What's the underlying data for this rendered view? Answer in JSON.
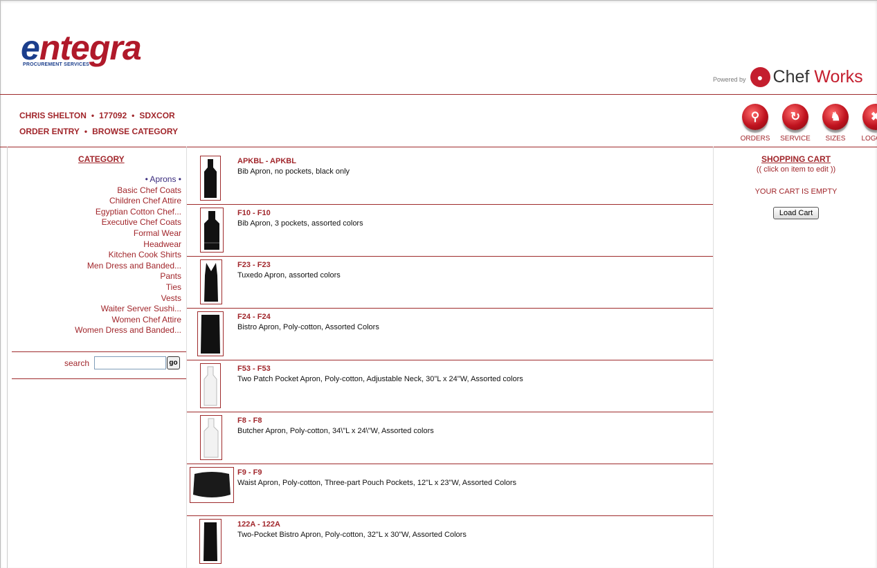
{
  "logo": {
    "word_start": "e",
    "word_rest": "ntegra",
    "subtitle": "PROCUREMENT SERVICES"
  },
  "powered": {
    "label": "Powered by",
    "brand_a": "Chef ",
    "brand_b": "Works"
  },
  "user": {
    "name": "CHRIS SHELTON",
    "id": "177092",
    "account": "SDXCOR"
  },
  "nav": {
    "order_entry": "ORDER ENTRY",
    "browse": "BROWSE CATEGORY"
  },
  "toolbar": [
    {
      "label": "ORDERS",
      "icon": "search-icon"
    },
    {
      "label": "SERVICE",
      "icon": "service-icon"
    },
    {
      "label": "SIZES",
      "icon": "pin-icon"
    },
    {
      "label": "LOGOFF",
      "icon": "close-icon"
    }
  ],
  "category": {
    "heading": "CATEGORY",
    "current": "• Aprons •",
    "items": [
      "Basic Chef Coats",
      "Children Chef Attire",
      "Egyptian Cotton Chef...",
      "Executive Chef Coats",
      "Formal Wear",
      "Headwear",
      "Kitchen Cook Shirts",
      "Men Dress and Banded...",
      "Pants",
      "Ties",
      "Vests",
      "Waiter Server Sushi...",
      "Women Chef Attire",
      "Women Dress and Banded..."
    ]
  },
  "search": {
    "label": "search",
    "value": "",
    "go": "go"
  },
  "products": [
    {
      "code": "APKBL - APKBL",
      "desc": "Bib Apron, no pockets, black only",
      "color": "#111"
    },
    {
      "code": "F10 - F10",
      "desc": "Bib Apron, 3 pockets, assorted colors",
      "color": "#111"
    },
    {
      "code": "F23 - F23",
      "desc": "Tuxedo Apron, assorted colors",
      "color": "#111"
    },
    {
      "code": "F24 - F24",
      "desc": "Bistro Apron, Poly-cotton, Assorted Colors",
      "color": "#111"
    },
    {
      "code": "F53 - F53",
      "desc": "Two Patch Pocket Apron, Poly-cotton, Adjustable Neck, 30\"L x 24\"W, Assorted colors",
      "color": "#f2f2f2"
    },
    {
      "code": "F8 - F8",
      "desc": "Butcher Apron, Poly-cotton, 34\\\"L x 24\\\"W, Assorted colors",
      "color": "#f2f2f2"
    },
    {
      "code": "F9 - F9",
      "desc": "Waist Apron, Poly-cotton, Three-part Pouch Pockets, 12\"L x 23\"W, Assorted Colors",
      "color": "#111"
    },
    {
      "code": "122A - 122A",
      "desc": "Two-Pocket Bistro Apron, Poly-cotton, 32\"L x 30\"W, Assorted Colors",
      "color": "#111"
    }
  ],
  "cart": {
    "title": "SHOPPING CART",
    "hint": "(( click on item to edit ))",
    "empty": "YOUR CART IS EMPTY",
    "load": "Load Cart"
  },
  "colors": {
    "accent": "#a1262b",
    "brand_blue": "#1b3e8c"
  }
}
